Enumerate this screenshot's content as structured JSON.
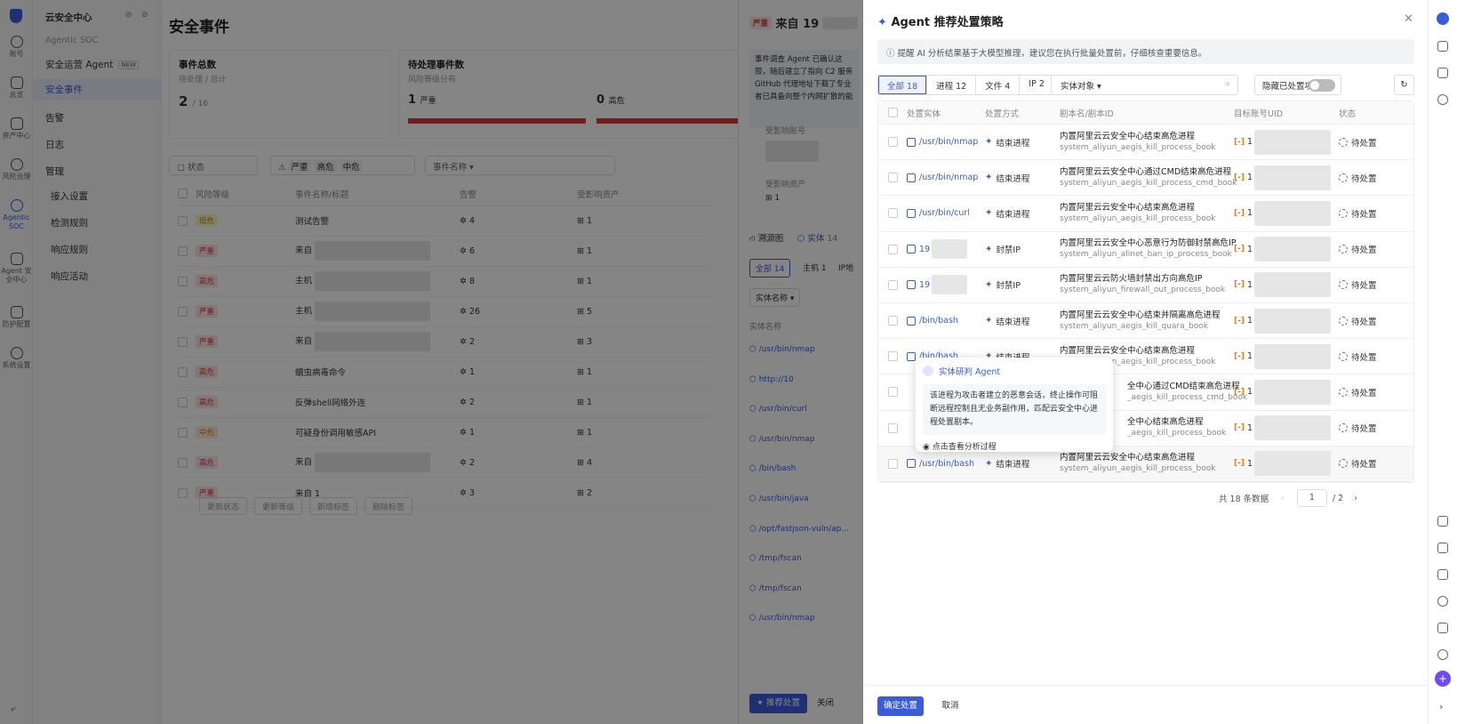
{
  "rail": {
    "items": [
      {
        "label": "账号"
      },
      {
        "label": "总览"
      },
      {
        "label": "资产中心"
      },
      {
        "label": "风险治理"
      },
      {
        "label": "Agentic SOC"
      },
      {
        "label": "Agent 安全中心"
      },
      {
        "label": "防护配置"
      },
      {
        "label": "系统设置"
      }
    ]
  },
  "nav": {
    "title": "云安全中心",
    "subtitle": "Agentic SOC",
    "items": [
      {
        "label": "安全运营 Agent",
        "badge": "NEW"
      },
      {
        "label": "安全事件"
      },
      {
        "label": "告警"
      },
      {
        "label": "日志"
      },
      {
        "label": "管理"
      },
      {
        "label": "接入设置"
      },
      {
        "label": "检测规则"
      },
      {
        "label": "响应规则"
      },
      {
        "label": "响应活动"
      }
    ]
  },
  "main": {
    "title": "安全事件",
    "card1": {
      "title": "事件总数",
      "sub": "待处理 / 总计",
      "value": "2",
      "total": "/ 16"
    },
    "card2": {
      "title": "待处理事件数",
      "sub": "风险等级分布",
      "v1": "1",
      "l1": "严重",
      "v2": "0",
      "l2": "高危"
    },
    "filter_status": "状态",
    "filter_chips": [
      "严重",
      "高危",
      "中危"
    ],
    "filter_name": "事件名称",
    "columns": [
      "风险等级",
      "事件名称/标题",
      "告警",
      "受影响资产"
    ],
    "rows": [
      {
        "level": "低危",
        "lc": "yel",
        "name": "测试告警",
        "alerts": "4",
        "assets": "1"
      },
      {
        "level": "严重",
        "lc": "red",
        "name": "来自",
        "alerts": "6",
        "assets": "1"
      },
      {
        "level": "高危",
        "lc": "red",
        "name": "主机",
        "alerts": "8",
        "assets": "1"
      },
      {
        "level": "严重",
        "lc": "red",
        "name": "主机",
        "alerts": "26",
        "assets": "5"
      },
      {
        "level": "严重",
        "lc": "red",
        "name": "来自",
        "alerts": "2",
        "assets": "3"
      },
      {
        "level": "高危",
        "lc": "red",
        "name": "蠕虫病毒命令",
        "alerts": "1",
        "assets": "1"
      },
      {
        "level": "高危",
        "lc": "red",
        "name": "反弹shell网络外连",
        "alerts": "2",
        "assets": "1"
      },
      {
        "level": "中危",
        "lc": "org",
        "name": "可疑身份调用敏感API",
        "alerts": "1",
        "assets": "1"
      },
      {
        "level": "高危",
        "lc": "red",
        "name": "来自",
        "alerts": "2",
        "assets": "4"
      },
      {
        "level": "严重",
        "lc": "red",
        "name": "来自 1",
        "alerts": "3",
        "assets": "2"
      }
    ],
    "bottom_buttons": [
      "更新状态",
      "更新等级",
      "新增标签",
      "删除标签"
    ]
  },
  "drawer": {
    "badge": "严重",
    "title": "来自 19",
    "desc": "事件调查 Agent 已确认这 限，随后建立了指向 C2 服务 GitHub 代理地址下载了专业 者已具备向整个内网扩散的能",
    "label1": "受影响账号",
    "label2": "受影响资产",
    "asset_count": "1",
    "tab1": "溯源图",
    "tab2": "实体",
    "tab2_count": "14",
    "subtabs": [
      "全部 14",
      "主机 1",
      "IP地"
    ],
    "entity_filter": "实体名称",
    "col": "实体名称",
    "entities": [
      "/usr/bin/nmap",
      "http://10",
      "/usr/bin/curl",
      "/usr/bin/nmap",
      "/bin/bash",
      "/usr/bin/java",
      "/opt/fastjson-vuln/ap...",
      "/tmp/fscan",
      "/tmp/fscan",
      "/usr/bin/nmap"
    ],
    "btn_primary": "推荐处置",
    "btn_close": "关闭"
  },
  "modal": {
    "title": "Agent 推荐处置策略",
    "alert": "提醒 AI 分析结果基于大模型推理，建议您在执行批量处置前，仔细核查重要信息。",
    "tabs": [
      "全部 18",
      "进程 12",
      "文件 4",
      "IP 2"
    ],
    "entity_type": "实体对象",
    "hide_label": "隐藏已处置项",
    "columns": [
      "处置实体",
      "处置方式",
      "剧本名/剧本ID",
      "目标账号UID",
      "状态"
    ],
    "rows": [
      {
        "entity": "/usr/bin/nmap",
        "action": "结束进程",
        "script": "内置阿里云云安全中心结束高危进程",
        "sid": "system_aliyun_aegis_kill_process_book",
        "uid": "1",
        "status": "待处置"
      },
      {
        "entity": "/usr/bin/nmap",
        "action": "结束进程",
        "script": "内置阿里云云安全中心通过CMD结束高危进程",
        "sid": "system_aliyun_aegis_kill_process_cmd_book",
        "uid": "1",
        "status": "待处置"
      },
      {
        "entity": "/usr/bin/curl",
        "action": "结束进程",
        "script": "内置阿里云云安全中心结束高危进程",
        "sid": "system_aliyun_aegis_kill_process_book",
        "uid": "1",
        "status": "待处置"
      },
      {
        "entity": "19",
        "action": "封禁IP",
        "script": "内置阿里云云安全中心恶意行为防御封禁高危IP",
        "sid": "system_aliyun_alinet_ban_ip_process_book",
        "uid": "1",
        "status": "待处置"
      },
      {
        "entity": "19",
        "action": "封禁IP",
        "script": "内置阿里云云防火墙封禁出方向高危IP",
        "sid": "system_aliyun_firewall_out_process_book",
        "uid": "1",
        "status": "待处置"
      },
      {
        "entity": "/bin/bash",
        "action": "结束进程",
        "script": "内置阿里云云安全中心结束并隔离高危进程",
        "sid": "system_aliyun_aegis_kill_quara_book",
        "uid": "1",
        "status": "待处置"
      },
      {
        "entity": "/bin/bash",
        "action": "结束进程",
        "script": "内置阿里云云安全中心结束高危进程",
        "sid": "system_aliyun_aegis_kill_process_book",
        "uid": "1",
        "status": "待处置"
      },
      {
        "entity": "",
        "action": "",
        "script": "全中心通过CMD结束高危进程",
        "sid": "_aegis_kill_process_cmd_book",
        "uid": "1",
        "status": "待处置"
      },
      {
        "entity": "",
        "action": "",
        "script": "全中心结束高危进程",
        "sid": "_aegis_kill_process_book",
        "uid": "1",
        "status": "待处置"
      },
      {
        "entity": "/usr/bin/bash",
        "action": "结束进程",
        "script": "内置阿里云云安全中心结束高危进程",
        "sid": "system_aliyun_aegis_kill_process_book",
        "uid": "1",
        "status": "待处置"
      }
    ],
    "pager": {
      "total": "共 18 条数据",
      "page": "1",
      "pages": "/ 2"
    },
    "popup": {
      "title": "实体研判 Agent",
      "body": "该进程为攻击者建立的恶意会话，终止操作可阻断远程控制且无业务副作用，匹配云安全中心进程处置剧本。",
      "link": "点击查看分析过程"
    },
    "ok": "确定处置",
    "cancel": "取消"
  },
  "colors": {
    "accent": "#3b5bdb",
    "danger": "#d63c3c",
    "warning": "#e8791a"
  }
}
